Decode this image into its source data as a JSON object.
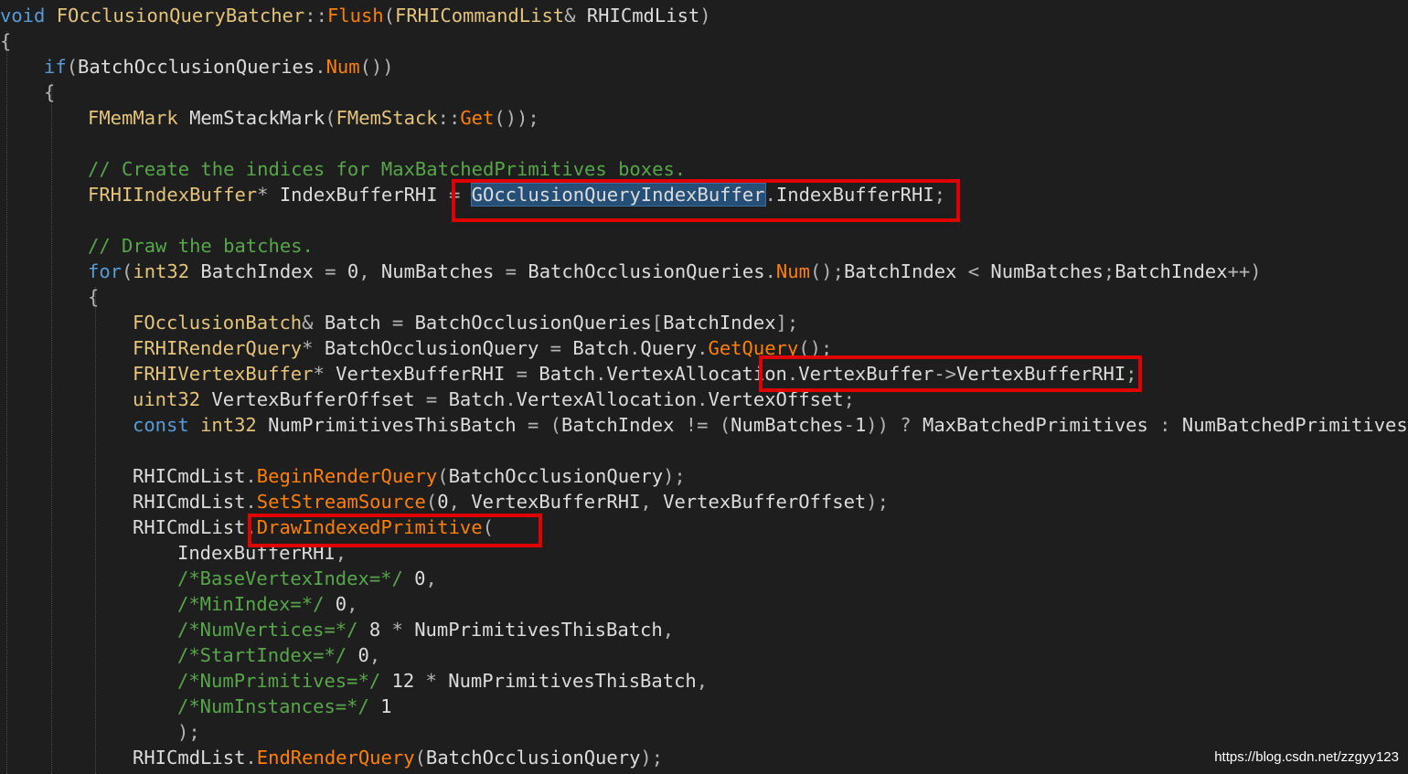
{
  "watermark": "https://blog.csdn.net/zzgyy123",
  "colors": {
    "background": "#1e1e1e",
    "keyword": "#569cd6",
    "type": "#e4c37a",
    "function": "#ff8000",
    "identifier": "#dcdcdc",
    "comment": "#57a64a",
    "selection": "#264f78",
    "highlight_box": "#e00000"
  },
  "code_lines": [
    {
      "indent": 0,
      "tokens": [
        [
          "kw",
          "void"
        ],
        [
          "id",
          " "
        ],
        [
          "type",
          "FOcclusionQueryBatcher"
        ],
        [
          "punc",
          "::"
        ],
        [
          "fn",
          "Flush"
        ],
        [
          "punc",
          "("
        ],
        [
          "type",
          "FRHICommandList"
        ],
        [
          "punc",
          "& "
        ],
        [
          "id",
          "RHICmdList"
        ],
        [
          "punc",
          ")"
        ]
      ]
    },
    {
      "indent": 0,
      "tokens": [
        [
          "punc",
          "{"
        ]
      ]
    },
    {
      "indent": 1,
      "tokens": [
        [
          "kw",
          "if"
        ],
        [
          "punc",
          "("
        ],
        [
          "id",
          "BatchOcclusionQueries"
        ],
        [
          "punc",
          "."
        ],
        [
          "fn",
          "Num"
        ],
        [
          "punc",
          "())"
        ]
      ]
    },
    {
      "indent": 1,
      "tokens": [
        [
          "punc",
          "{"
        ]
      ]
    },
    {
      "indent": 2,
      "tokens": [
        [
          "type",
          "FMemMark"
        ],
        [
          "id",
          " MemStackMark"
        ],
        [
          "punc",
          "("
        ],
        [
          "type",
          "FMemStack"
        ],
        [
          "punc",
          "::"
        ],
        [
          "fn",
          "Get"
        ],
        [
          "punc",
          "());"
        ]
      ]
    },
    {
      "indent": 2,
      "tokens": []
    },
    {
      "indent": 2,
      "tokens": [
        [
          "comment",
          "// Create the indices for MaxBatchedPrimitives boxes."
        ]
      ]
    },
    {
      "indent": 2,
      "tokens": [
        [
          "type",
          "FRHIIndexBuffer"
        ],
        [
          "punc",
          "* "
        ],
        [
          "id",
          "IndexBufferRHI"
        ],
        [
          "punc",
          " = "
        ],
        [
          "sel",
          "GOcclusionQueryIndexBuffer"
        ],
        [
          "punc",
          "."
        ],
        [
          "id",
          "IndexBufferRHI"
        ],
        [
          "punc",
          ";"
        ]
      ]
    },
    {
      "indent": 2,
      "tokens": []
    },
    {
      "indent": 2,
      "tokens": [
        [
          "comment",
          "// Draw the batches."
        ]
      ]
    },
    {
      "indent": 2,
      "tokens": [
        [
          "kw",
          "for"
        ],
        [
          "punc",
          "("
        ],
        [
          "type",
          "int32"
        ],
        [
          "id",
          " BatchIndex"
        ],
        [
          "punc",
          " = "
        ],
        [
          "num",
          "0"
        ],
        [
          "punc",
          ", "
        ],
        [
          "id",
          "NumBatches"
        ],
        [
          "punc",
          " = "
        ],
        [
          "id",
          "BatchOcclusionQueries"
        ],
        [
          "punc",
          "."
        ],
        [
          "fn",
          "Num"
        ],
        [
          "punc",
          "();"
        ],
        [
          "id",
          "BatchIndex"
        ],
        [
          "punc",
          " < "
        ],
        [
          "id",
          "NumBatches"
        ],
        [
          "punc",
          ";"
        ],
        [
          "id",
          "BatchIndex"
        ],
        [
          "punc",
          "++)"
        ]
      ]
    },
    {
      "indent": 2,
      "tokens": [
        [
          "punc",
          "{"
        ]
      ]
    },
    {
      "indent": 3,
      "tokens": [
        [
          "type",
          "FOcclusionBatch"
        ],
        [
          "punc",
          "& "
        ],
        [
          "id",
          "Batch"
        ],
        [
          "punc",
          " = "
        ],
        [
          "id",
          "BatchOcclusionQueries"
        ],
        [
          "punc",
          "["
        ],
        [
          "id",
          "BatchIndex"
        ],
        [
          "punc",
          "];"
        ]
      ]
    },
    {
      "indent": 3,
      "tokens": [
        [
          "type",
          "FRHIRenderQuery"
        ],
        [
          "punc",
          "* "
        ],
        [
          "id",
          "BatchOcclusionQuery"
        ],
        [
          "punc",
          " = "
        ],
        [
          "id",
          "Batch"
        ],
        [
          "punc",
          "."
        ],
        [
          "id",
          "Query"
        ],
        [
          "punc",
          "."
        ],
        [
          "fn",
          "GetQuery"
        ],
        [
          "punc",
          "();"
        ]
      ]
    },
    {
      "indent": 3,
      "tokens": [
        [
          "type",
          "FRHIVertexBuffer"
        ],
        [
          "punc",
          "* "
        ],
        [
          "id",
          "VertexBufferRHI"
        ],
        [
          "punc",
          " = "
        ],
        [
          "id",
          "Batch"
        ],
        [
          "punc",
          "."
        ],
        [
          "id",
          "VertexAllocation"
        ],
        [
          "punc",
          "."
        ],
        [
          "id",
          "VertexBuffer"
        ],
        [
          "punc",
          "->"
        ],
        [
          "id",
          "VertexBufferRHI"
        ],
        [
          "punc",
          ";"
        ]
      ]
    },
    {
      "indent": 3,
      "tokens": [
        [
          "type",
          "uint32"
        ],
        [
          "id",
          " VertexBufferOffset"
        ],
        [
          "punc",
          " = "
        ],
        [
          "id",
          "Batch"
        ],
        [
          "punc",
          "."
        ],
        [
          "id",
          "VertexAllocation"
        ],
        [
          "punc",
          "."
        ],
        [
          "id",
          "VertexOffset"
        ],
        [
          "punc",
          ";"
        ]
      ]
    },
    {
      "indent": 3,
      "tokens": [
        [
          "kw",
          "const"
        ],
        [
          "id",
          " "
        ],
        [
          "type",
          "int32"
        ],
        [
          "id",
          " NumPrimitivesThisBatch"
        ],
        [
          "punc",
          " = ("
        ],
        [
          "id",
          "BatchIndex"
        ],
        [
          "punc",
          " != ("
        ],
        [
          "id",
          "NumBatches"
        ],
        [
          "punc",
          "-"
        ],
        [
          "num",
          "1"
        ],
        [
          "punc",
          ")) ? "
        ],
        [
          "id",
          "MaxBatchedPrimitives"
        ],
        [
          "punc",
          " : "
        ],
        [
          "id",
          "NumBatchedPrimitives"
        ],
        [
          "punc",
          ";"
        ]
      ]
    },
    {
      "indent": 3,
      "tokens": []
    },
    {
      "indent": 3,
      "tokens": [
        [
          "id",
          "RHICmdList"
        ],
        [
          "punc",
          "."
        ],
        [
          "fn",
          "BeginRenderQuery"
        ],
        [
          "punc",
          "("
        ],
        [
          "id",
          "BatchOcclusionQuery"
        ],
        [
          "punc",
          ");"
        ]
      ]
    },
    {
      "indent": 3,
      "tokens": [
        [
          "id",
          "RHICmdList"
        ],
        [
          "punc",
          "."
        ],
        [
          "fn",
          "SetStreamSource"
        ],
        [
          "punc",
          "("
        ],
        [
          "num",
          "0"
        ],
        [
          "punc",
          ", "
        ],
        [
          "id",
          "VertexBufferRHI"
        ],
        [
          "punc",
          ", "
        ],
        [
          "id",
          "VertexBufferOffset"
        ],
        [
          "punc",
          ");"
        ]
      ]
    },
    {
      "indent": 3,
      "tokens": [
        [
          "id",
          "RHICmdList"
        ],
        [
          "punc",
          "."
        ],
        [
          "fn",
          "DrawIndexedPrimitive"
        ],
        [
          "punc",
          "("
        ]
      ]
    },
    {
      "indent": 4,
      "tokens": [
        [
          "id",
          "IndexBufferRHI"
        ],
        [
          "punc",
          ","
        ]
      ]
    },
    {
      "indent": 4,
      "tokens": [
        [
          "icom",
          "/*BaseVertexIndex=*/"
        ],
        [
          "num",
          " 0"
        ],
        [
          "punc",
          ","
        ]
      ]
    },
    {
      "indent": 4,
      "tokens": [
        [
          "icom",
          "/*MinIndex=*/"
        ],
        [
          "num",
          " 0"
        ],
        [
          "punc",
          ","
        ]
      ]
    },
    {
      "indent": 4,
      "tokens": [
        [
          "icom",
          "/*NumVertices=*/"
        ],
        [
          "num",
          " 8"
        ],
        [
          "punc",
          " * "
        ],
        [
          "id",
          "NumPrimitivesThisBatch"
        ],
        [
          "punc",
          ","
        ]
      ]
    },
    {
      "indent": 4,
      "tokens": [
        [
          "icom",
          "/*StartIndex=*/"
        ],
        [
          "num",
          " 0"
        ],
        [
          "punc",
          ","
        ]
      ]
    },
    {
      "indent": 4,
      "tokens": [
        [
          "icom",
          "/*NumPrimitives=*/"
        ],
        [
          "num",
          " 12"
        ],
        [
          "punc",
          " * "
        ],
        [
          "id",
          "NumPrimitivesThisBatch"
        ],
        [
          "punc",
          ","
        ]
      ]
    },
    {
      "indent": 4,
      "tokens": [
        [
          "icom",
          "/*NumInstances=*/"
        ],
        [
          "num",
          " 1"
        ]
      ]
    },
    {
      "indent": 4,
      "tokens": [
        [
          "punc",
          ");"
        ]
      ]
    },
    {
      "indent": 3,
      "tokens": [
        [
          "id",
          "RHICmdList"
        ],
        [
          "punc",
          "."
        ],
        [
          "fn",
          "EndRenderQuery"
        ],
        [
          "punc",
          "("
        ],
        [
          "id",
          "BatchOcclusionQuery"
        ],
        [
          "punc",
          ");"
        ]
      ]
    }
  ]
}
